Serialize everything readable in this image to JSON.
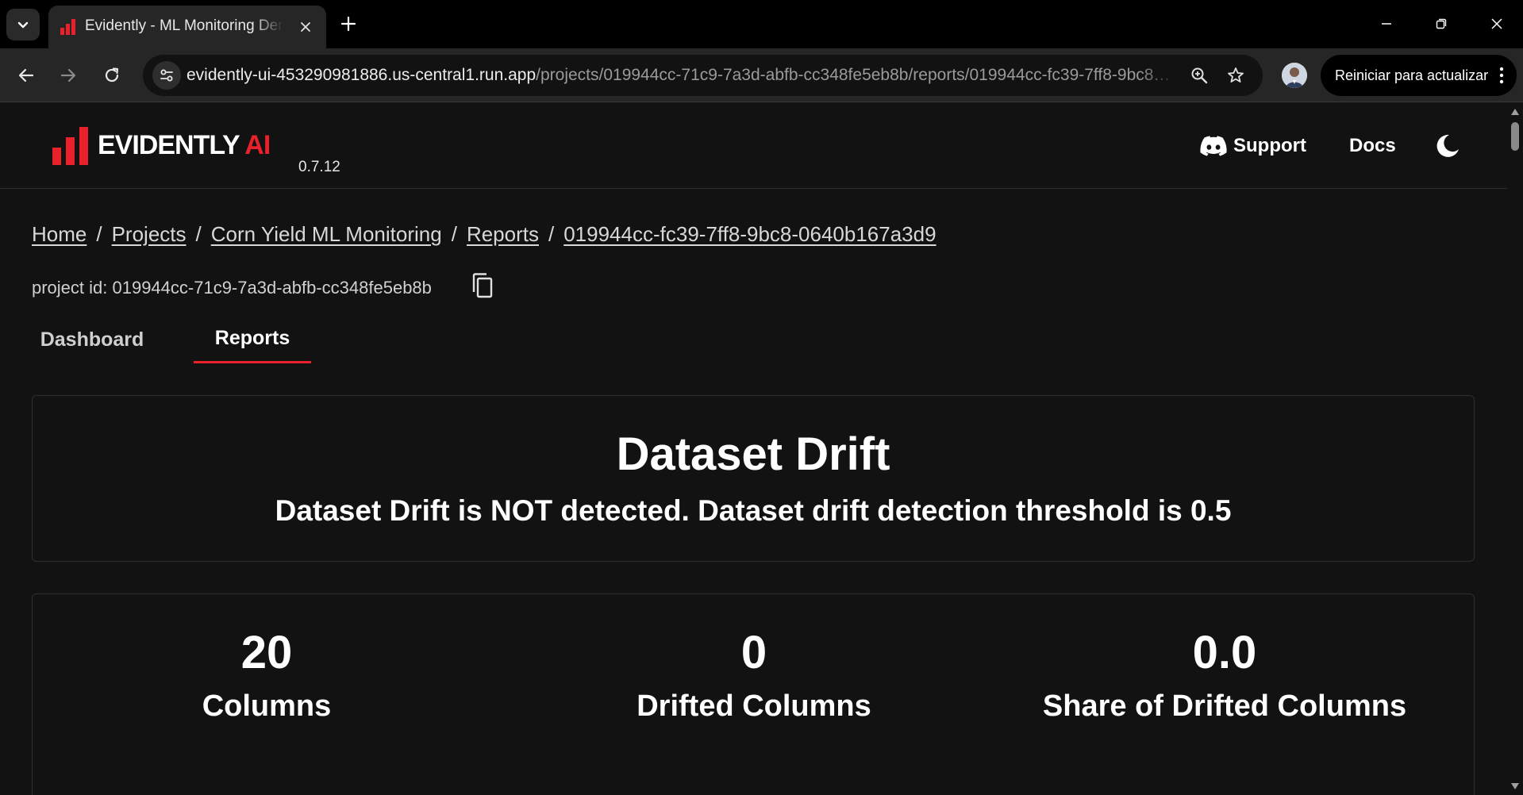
{
  "browser": {
    "tab_title": "Evidently - ML Monitoring Demo",
    "url_host": "evidently-ui-453290981886.us-central1.run.app",
    "url_path": "/projects/019944cc-71c9-7a3d-abfb-cc348fe5eb8b/reports/019944cc-fc39-7ff8-9bc8…",
    "update_button_label": "Reiniciar para actualizar"
  },
  "header": {
    "logo_text_main": "EVIDENTLY",
    "logo_text_accent": "AI",
    "version": "0.7.12",
    "support_label": "Support",
    "docs_label": "Docs"
  },
  "breadcrumb": {
    "items": [
      "Home",
      "Projects",
      "Corn Yield ML Monitoring",
      "Reports",
      "019944cc-fc39-7ff8-9bc8-0640b167a3d9"
    ],
    "separator": "/"
  },
  "project": {
    "id_text": "project id: 019944cc-71c9-7a3d-abfb-cc348fe5eb8b"
  },
  "tabs": [
    {
      "label": "Dashboard",
      "active": false
    },
    {
      "label": "Reports",
      "active": true
    }
  ],
  "drift_card": {
    "title": "Dataset Drift",
    "subtitle": "Dataset Drift is NOT detected. Dataset drift detection threshold is 0.5"
  },
  "metrics": [
    {
      "value": "20",
      "label": "Columns"
    },
    {
      "value": "0",
      "label": "Drifted Columns"
    },
    {
      "value": "0.0",
      "label": "Share of Drifted Columns"
    }
  ],
  "colors": {
    "accent": "#e8212a",
    "background": "#121212",
    "text": "#ffffff"
  },
  "icons": {
    "tab_list": "chevron-down-icon",
    "close_tab": "close-icon",
    "new_tab": "plus-icon",
    "back": "arrow-left-icon",
    "forward": "arrow-right-icon",
    "reload": "reload-icon",
    "site_info": "tune-icon",
    "zoom": "zoom-icon",
    "bookmark": "star-icon",
    "menu": "kebab-menu-icon",
    "support": "discord-icon",
    "theme": "moon-icon",
    "copy": "copy-icon"
  }
}
